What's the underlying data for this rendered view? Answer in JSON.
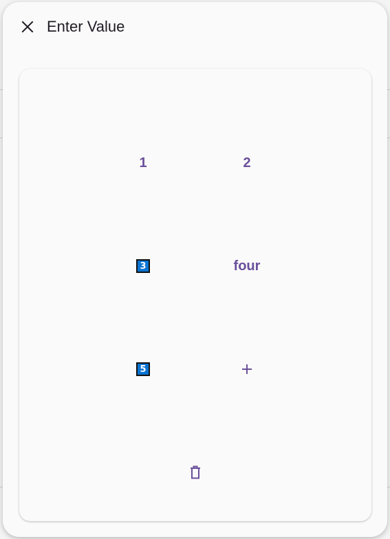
{
  "dialog": {
    "title": "Enter Value",
    "close_icon": "close-icon"
  },
  "keypad": {
    "keys": [
      {
        "label": "1",
        "style": "text"
      },
      {
        "label": "2",
        "style": "text"
      },
      {
        "label": "3",
        "style": "badge"
      },
      {
        "label": "four",
        "style": "text"
      },
      {
        "label": "5",
        "style": "badge"
      },
      {
        "icon": "plus-icon"
      },
      {
        "icon": "trash-icon"
      }
    ]
  },
  "colors": {
    "accent": "#6a4f9a",
    "badge_bg": "#0a74d2",
    "dialog_bg": "#fafafa",
    "title_text": "#1f1b24"
  }
}
